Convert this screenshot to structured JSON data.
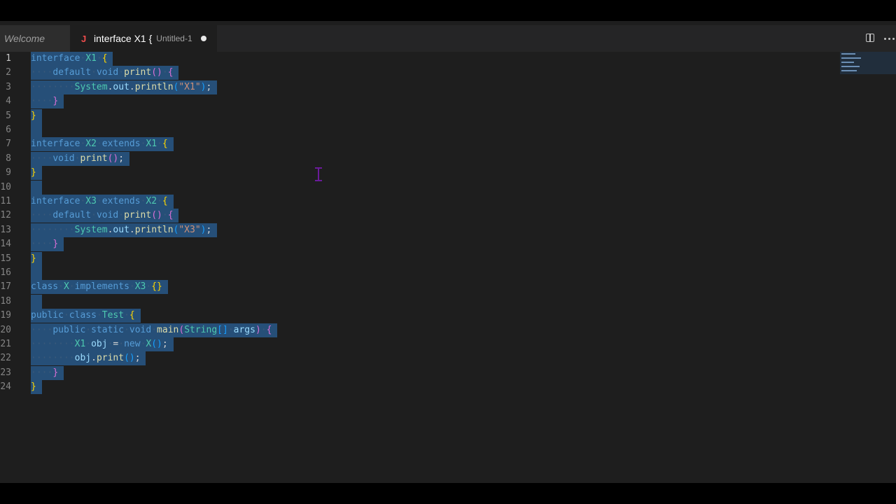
{
  "tabs": {
    "welcome": "Welcome",
    "active_title": "interface X1 {",
    "active_desc": "Untitled-1",
    "active_icon": "java-file-icon"
  },
  "actions": [
    "split-editor-icon",
    "more-actions-icon"
  ],
  "editor": {
    "language": "java",
    "selection": "all",
    "active_line": 1,
    "lines": [
      "interface X1 {",
      "    default void print() {",
      "        System.out.println(\"X1\");",
      "    }",
      "}",
      "",
      "interface X2 extends X1 {",
      "    void print();",
      "}",
      "",
      "interface X3 extends X2 {",
      "    default void print() {",
      "        System.out.println(\"X3\");",
      "    }",
      "}",
      "",
      "class X implements X3 {}",
      "",
      "public class Test {",
      "    public static void main(String[] args) {",
      "        X1 obj = new X();",
      "        obj.print();",
      "    }",
      "}"
    ]
  },
  "colors": {
    "background": "#1e1e1e",
    "selection": "#264f78",
    "keyword": "#569cd6",
    "type": "#4ec9b0",
    "function": "#dcdcaa",
    "string": "#ce9178"
  }
}
